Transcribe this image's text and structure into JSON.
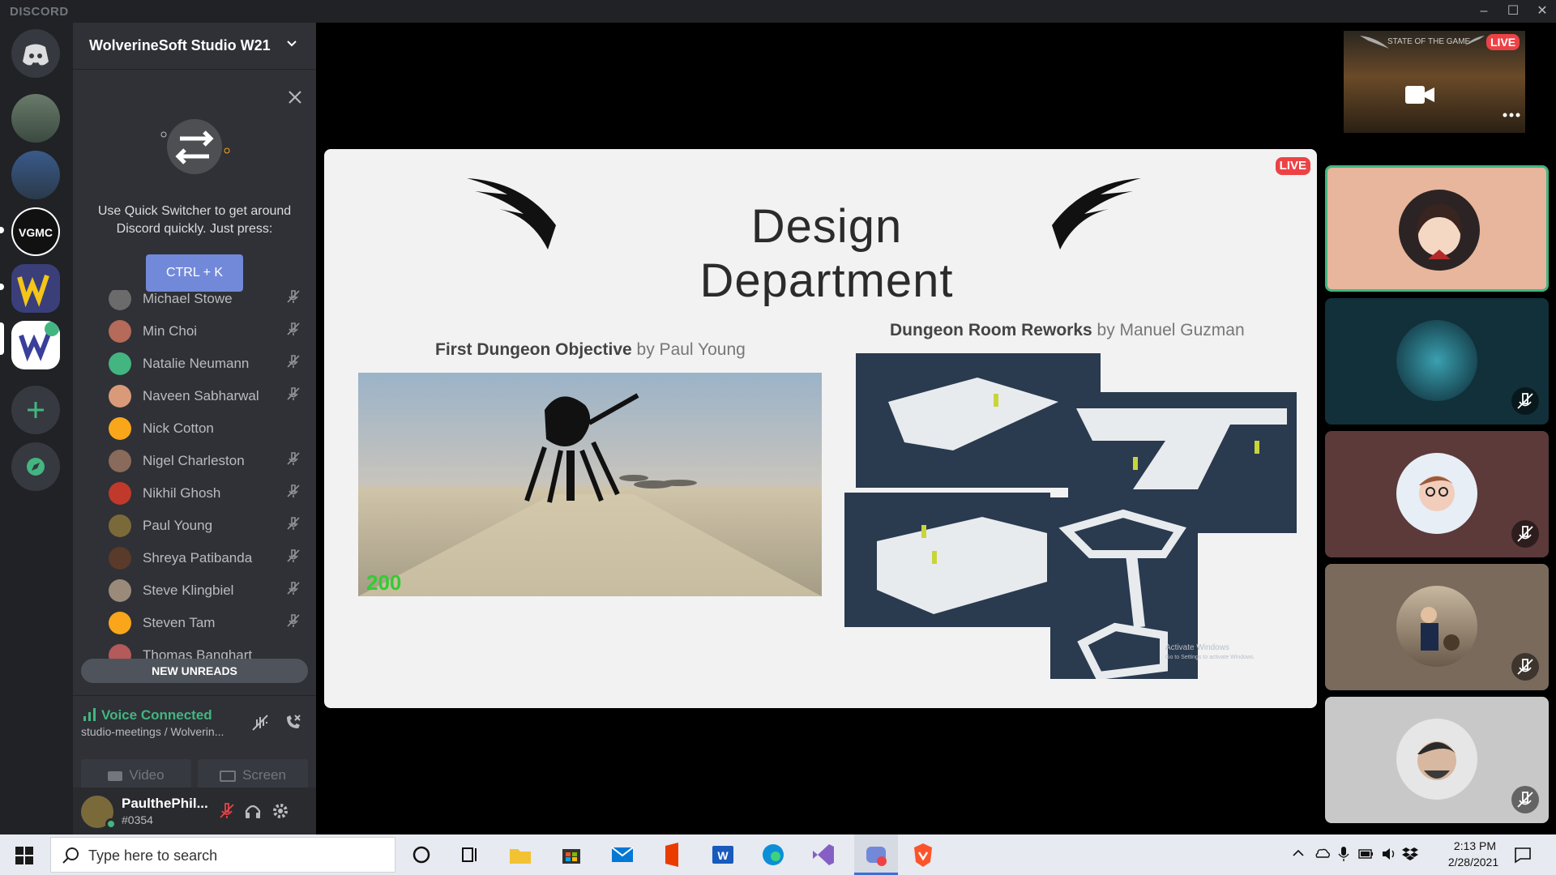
{
  "app": {
    "brand": "DISCORD",
    "window_controls": [
      "minimize",
      "maximize",
      "close"
    ]
  },
  "server": {
    "name": "WolverineSoft Studio W21"
  },
  "quick_switcher": {
    "text": "Use Quick Switcher to get around Discord quickly. Just press:",
    "shortcut": "CTRL + K"
  },
  "members": [
    {
      "name": "Michael Stowe",
      "muted": true
    },
    {
      "name": "Min Choi",
      "muted": true
    },
    {
      "name": "Natalie Neumann",
      "muted": true
    },
    {
      "name": "Naveen Sabharwal",
      "muted": true
    },
    {
      "name": "Nick Cotton",
      "muted": false
    },
    {
      "name": "Nigel Charleston",
      "muted": true
    },
    {
      "name": "Nikhil Ghosh",
      "muted": true
    },
    {
      "name": "Paul Young",
      "muted": true
    },
    {
      "name": "Shreya Patibanda",
      "muted": true
    },
    {
      "name": "Steve Klingbiel",
      "muted": true
    },
    {
      "name": "Steven Tam",
      "muted": true
    },
    {
      "name": "Thomas Banghart",
      "muted": true
    }
  ],
  "new_unreads": "NEW UNREADS",
  "voice": {
    "status": "Voice Connected",
    "channel": "studio-meetings / Wolverin...",
    "video_label": "Video",
    "screen_label": "Screen"
  },
  "user": {
    "name": "PaulthePhil...",
    "tag": "#0354"
  },
  "stream": {
    "live_badge": "LIVE",
    "slide_title": "Design Department",
    "left_caption_title": "First Dungeon Objective",
    "left_caption_by": "by Paul Young",
    "right_caption_title": "Dungeon Room Reworks",
    "right_caption_by": "by Manuel Guzman",
    "score_text": "200",
    "watermark_line1": "Activate Windows",
    "watermark_line2": "Go to Settings to activate Windows."
  },
  "top_stream": {
    "title": "STATE OF THE GAME",
    "live_badge": "LIVE"
  },
  "taskbar": {
    "search_placeholder": "Type here to search",
    "time": "2:13 PM",
    "date": "2/28/2021"
  },
  "colors": {
    "blurple": "#7289da",
    "green": "#43b581",
    "live_red": "#ed4245",
    "sidebar": "#2f3136",
    "rail": "#202225"
  }
}
